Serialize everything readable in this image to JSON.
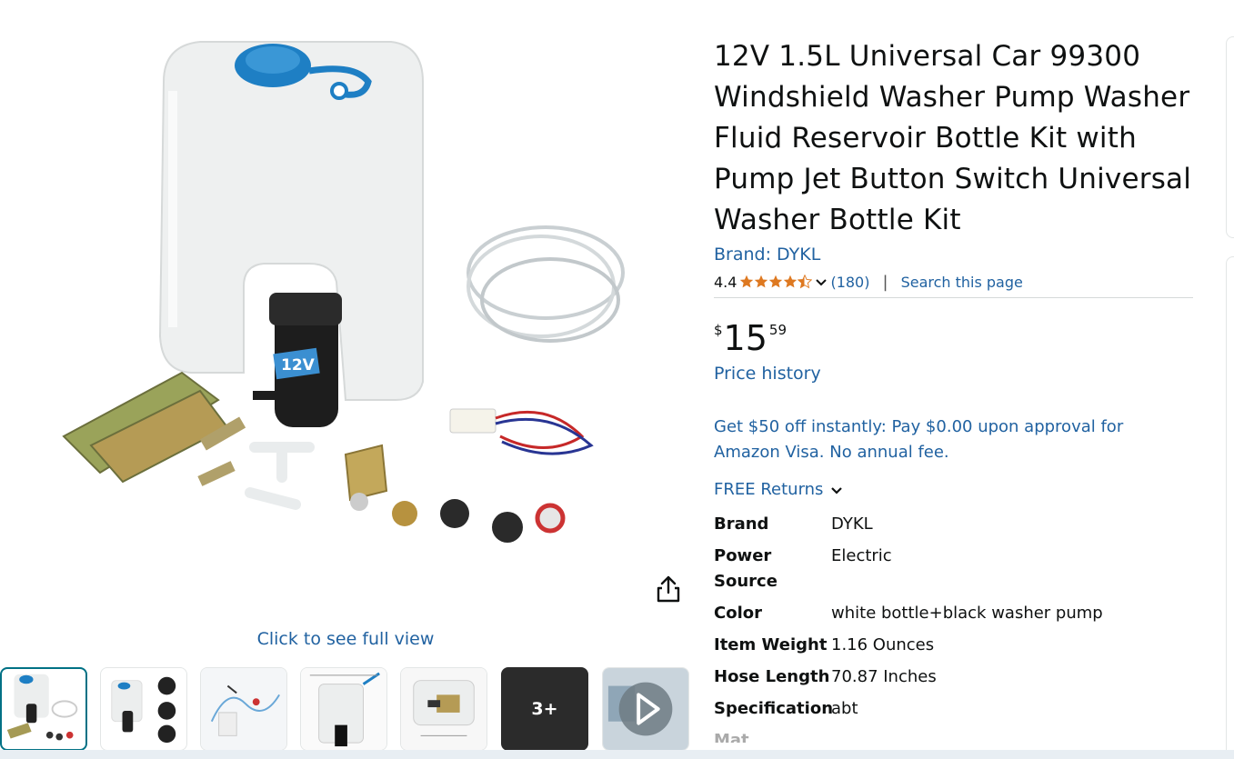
{
  "product": {
    "title": "12V 1.5L Universal Car 99300 Windshield Washer Pump Washer Fluid Reservoir Bottle Kit with Pump Jet Button Switch Universal Washer Bottle Kit",
    "brand_link": "Brand: DYKL",
    "rating": "4.4",
    "rating_stars": 4.4,
    "rating_count": "(180)",
    "search_page": "Search this page",
    "price": {
      "symbol": "$",
      "whole": "15",
      "fraction": "59"
    },
    "price_history": "Price history",
    "promo": "Get $50 off instantly: Pay $0.00 upon approval for Amazon Visa. No annual fee.",
    "returns": "FREE Returns",
    "specs": [
      {
        "label": "Brand",
        "value": "DYKL"
      },
      {
        "label": "Power Source",
        "value": "Electric"
      },
      {
        "label": "Color",
        "value": "white bottle+black washer pump"
      },
      {
        "label": "Item Weight",
        "value": "1.16 Ounces"
      },
      {
        "label": "Hose Length",
        "value": "70.87 Inches"
      },
      {
        "label": "Specification",
        "value": "abt"
      }
    ],
    "spec_cut_label": "Mat"
  },
  "gallery": {
    "full_view": "Click to see full view",
    "more_label": "3+",
    "bottle_label": "12V"
  },
  "colors": {
    "link": "#2162a1",
    "star": "#de7921",
    "active_thumb": "#007185"
  }
}
